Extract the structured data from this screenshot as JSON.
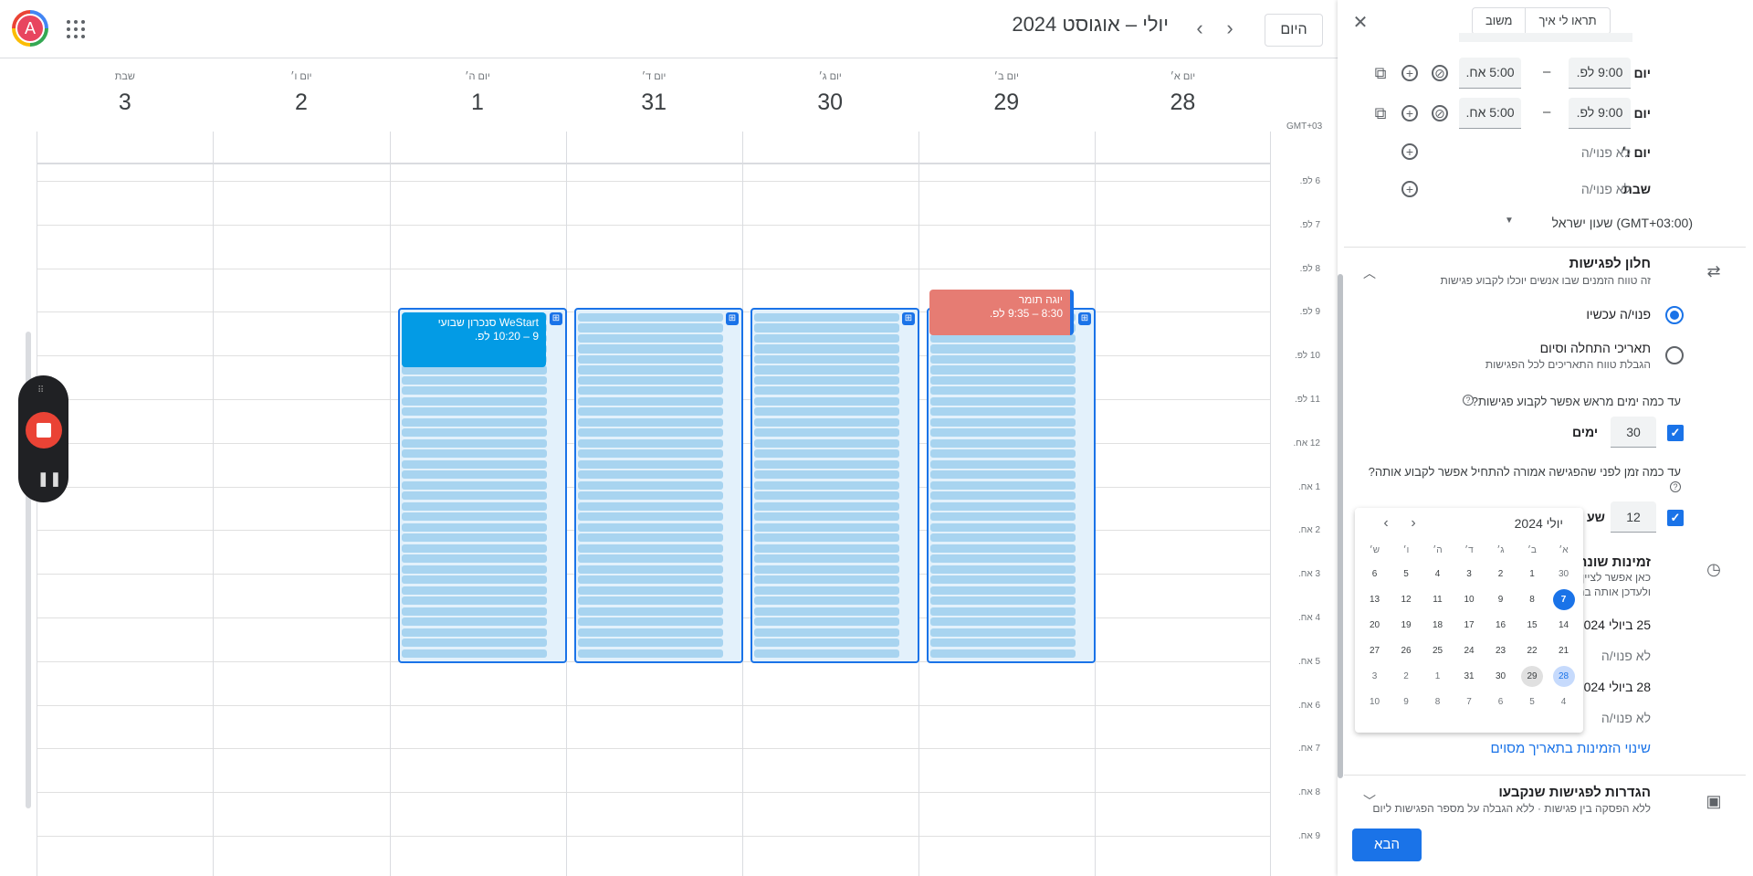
{
  "header": {
    "avatar_letter": "A",
    "title": "יולי – אוגוסט 2024",
    "today_label": "היום",
    "prev_icon": "chevron-right-icon",
    "next_icon": "chevron-left-icon"
  },
  "days": [
    {
      "name": "יום א׳",
      "date": "28"
    },
    {
      "name": "יום ב׳",
      "date": "29"
    },
    {
      "name": "יום ג׳",
      "date": "30"
    },
    {
      "name": "יום ד׳",
      "date": "31"
    },
    {
      "name": "יום ה׳",
      "date": "1"
    },
    {
      "name": "יום ו׳",
      "date": "2"
    },
    {
      "name": "שבת",
      "date": "3"
    }
  ],
  "timezone_label": "GMT+03",
  "time_labels": [
    "6 לפ.",
    "7 לפ.",
    "8 לפ.",
    "9 לפ.",
    "10 לפ.",
    "11 לפ.",
    "12 אח.",
    "1 אח.",
    "2 אח.",
    "3 אח.",
    "4 אח.",
    "5 אח.",
    "6 אח.",
    "7 אח.",
    "8 אח.",
    "9 אח."
  ],
  "events": {
    "yoga": {
      "title": "יוגה תומר",
      "time": "8:30 – 9:35 לפ.",
      "color": "#e67c73"
    },
    "westart": {
      "title": "WeStart סנכרון שבועי",
      "time": "9 – 10:20 לפ.",
      "color": "#039be5"
    }
  },
  "panel": {
    "top_buttons": [
      "תראו לי איך",
      "משוב"
    ],
    "weekly": [
      {
        "day": "יום ד׳",
        "from": "9:00 לפ.",
        "to": "5:00 אח."
      },
      {
        "day": "יום ה׳",
        "from": "9:00 לפ.",
        "to": "5:00 אח."
      },
      {
        "day": "יום ו׳",
        "status": "לא פנוי/ה"
      },
      {
        "day": "שבת",
        "status": "לא פנוי/ה"
      }
    ],
    "dash": "–",
    "timezone": "(GMT+03:00) שעון ישראל",
    "scheduling_window": {
      "title": "חלון לפגישות",
      "subtitle": "זה טווח הזמנים שבו אנשים יוכלו לקבוע פגישות",
      "option_now": "פנוי/ה עכשיו",
      "option_range": "תאריכי התחלה וסיום",
      "option_range_sub": "הגבלת טווח התאריכים לכל הפגישות",
      "advance_question": "עד כמה ימים מראש אפשר לקבוע פגישות?",
      "advance_value": "30",
      "advance_unit": "ימים",
      "min_notice_question": "עד כמה זמן לפני שהפגישה אמורה להתחיל אפשר לקבוע אותה?",
      "min_notice_value": "12",
      "min_notice_unit": "שע"
    },
    "override": {
      "title": "זמינות שונה",
      "sub1": "כאן אפשר לציין אם יו",
      "sub2": "ולעדכן אותה בהם",
      "date1": "25 ביולי 2024",
      "status1": "לא פנוי/ה",
      "date2": "28 ביולי 2024",
      "status2": "לא פנוי/ה",
      "link": "שינוי הזמינות בתאריך מסוים"
    },
    "booked": {
      "title": "הגדרות לפגישות שנקבעו",
      "subtitle": "ללא הפסקה בין פגישות · ללא הגבלה על מספר הפגישות ליום"
    },
    "next_label": "הבא"
  },
  "datepicker": {
    "title": "יולי 2024",
    "weekdays": [
      "א׳",
      "ב׳",
      "ג׳",
      "ד׳",
      "ה׳",
      "ו׳",
      "ש׳"
    ],
    "weeks": [
      [
        "30",
        "1",
        "2",
        "3",
        "4",
        "5",
        "6"
      ],
      [
        "7",
        "8",
        "9",
        "10",
        "11",
        "12",
        "13"
      ],
      [
        "14",
        "15",
        "16",
        "17",
        "18",
        "19",
        "20"
      ],
      [
        "21",
        "22",
        "23",
        "24",
        "25",
        "26",
        "27"
      ],
      [
        "28",
        "29",
        "30",
        "31",
        "1",
        "2",
        "3"
      ],
      [
        "4",
        "5",
        "6",
        "7",
        "8",
        "9",
        "10"
      ]
    ],
    "selected": "7",
    "highlighted": "28",
    "today_marked": "29"
  },
  "colors": {
    "accent": "#1a73e8",
    "slot": "#a8d4f0",
    "record": "#ea4335"
  }
}
